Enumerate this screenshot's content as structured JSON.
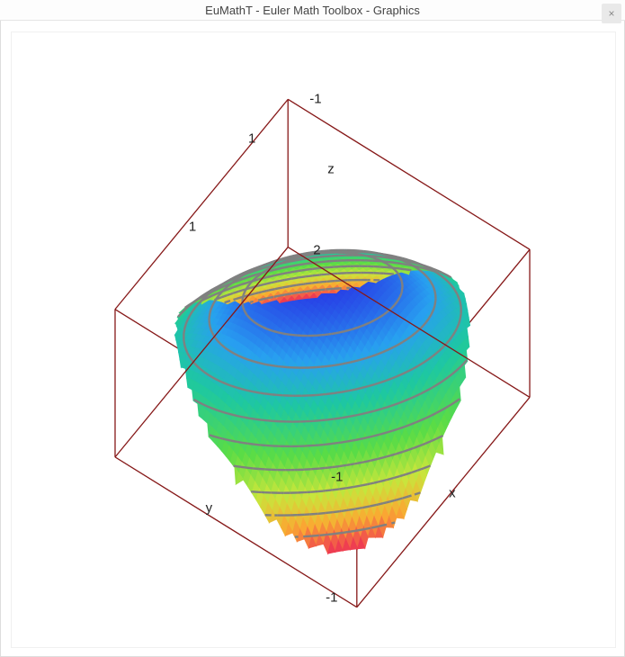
{
  "window": {
    "title": "EuMathT - Euler Math Toolbox - Graphics",
    "close_glyph": "×"
  },
  "chart_data": {
    "type": "surface3d",
    "title": "",
    "description": "3D surface over the unit disk, colored by height with grey level contours",
    "axes": {
      "x": {
        "label": "x",
        "range": [
          -1,
          1
        ],
        "ticks_shown": [
          -1,
          1
        ]
      },
      "y": {
        "label": "y",
        "range": [
          -1,
          1
        ],
        "ticks_shown": [
          -1,
          1
        ]
      },
      "z": {
        "label": "z",
        "range": [
          -1,
          2
        ],
        "ticks_shown": [
          -1,
          2
        ]
      }
    },
    "domain": {
      "shape": "disk",
      "radius": 1,
      "center": [
        0,
        0
      ]
    },
    "formula_estimate": "z ≈ x^2 + y^2 + x*y  (saddle-like surface clipped to unit disk, rising toward two adjacent corners)",
    "corner_heights_estimate": {
      "x=-1,y=-1": 1.0,
      "x=-1,y=1": 2.0,
      "x=1,y=-1": 0.0,
      "x=1,y=1": 1.0
    },
    "contour_levels_estimate": [
      -1.0,
      -0.7,
      -0.4,
      -0.1,
      0.2,
      0.5,
      0.8,
      1.1,
      1.4,
      1.7,
      2.0
    ],
    "colormap": "spectral (blue→green→yellow→red by increasing z)",
    "bounding_box_edge_color": "#861818",
    "contour_line_color": "#808080"
  },
  "labels3d": {
    "y_axis": "y",
    "x_axis": "x",
    "z_axis": "z",
    "y_tick_pos": "1",
    "y_tick_neg": "-1",
    "x_tick_pos": "1",
    "x_tick_neg": "-1",
    "z_tick_pos": "2",
    "z_tick_neg": "-1"
  }
}
